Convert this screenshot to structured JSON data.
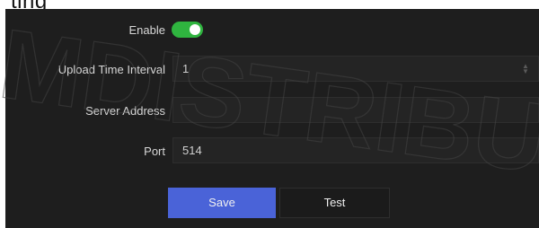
{
  "page": {
    "title_fragment": "ting"
  },
  "form": {
    "enable": {
      "label": "Enable",
      "checked": true,
      "color": "#2fb43f"
    },
    "upload_interval": {
      "label": "Upload Time Interval",
      "value": "1"
    },
    "server_address": {
      "label": "Server Address",
      "value": ""
    },
    "port": {
      "label": "Port",
      "value": "514"
    }
  },
  "buttons": {
    "save_label": "Save",
    "test_label": "Test",
    "save_color": "#4a63d8"
  },
  "watermark": {
    "text": "MDISTRIBU"
  }
}
